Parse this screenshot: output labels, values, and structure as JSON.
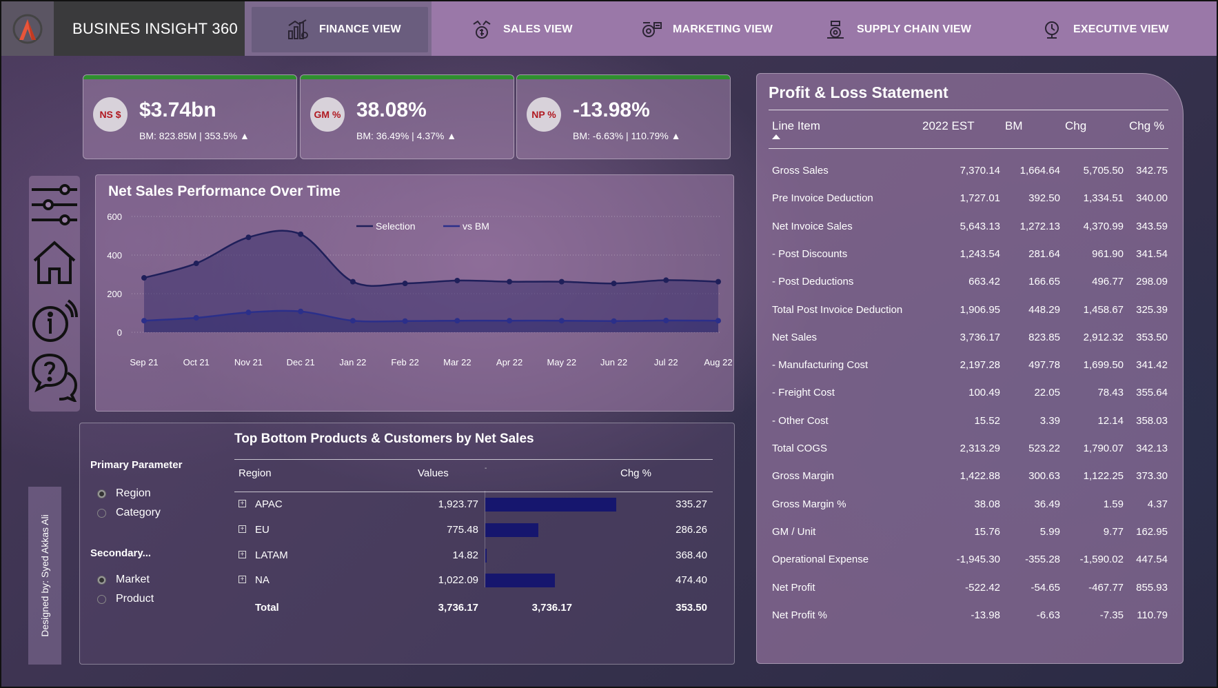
{
  "app": {
    "title": "BUSINES INSIGHT 360",
    "logo_icon": "atliq-logo-icon",
    "brand_color": "#e8553a"
  },
  "nav": [
    {
      "label": "FINANCE VIEW",
      "icon": "finance-chart-icon",
      "active": true
    },
    {
      "label": "SALES VIEW",
      "icon": "sales-icon",
      "active": false
    },
    {
      "label": "MARKETING VIEW",
      "icon": "marketing-icon",
      "active": false
    },
    {
      "label": "SUPPLY CHAIN VIEW",
      "icon": "supply-chain-icon",
      "active": false
    },
    {
      "label": "EXECUTIVE VIEW",
      "icon": "executive-icon",
      "active": false
    }
  ],
  "kpis": [
    {
      "badge": "NS $",
      "value": "$3.74bn",
      "sub": "BM: 823.85M | 353.5% ▲"
    },
    {
      "badge": "GM %",
      "value": "38.08%",
      "sub": "BM: 36.49% | 4.37% ▲"
    },
    {
      "badge": "NP %",
      "value": "-13.98%",
      "sub": "BM: -6.63% | 110.79% ▲"
    }
  ],
  "side_nav": [
    {
      "icon": "filter-sliders-icon"
    },
    {
      "icon": "home-icon"
    },
    {
      "icon": "info-icon"
    },
    {
      "icon": "help-chat-icon"
    }
  ],
  "credit": "Designed by: Syed Akkas Ali",
  "chart": {
    "title": "Net Sales Performance Over Time"
  },
  "chart_data": {
    "type": "area",
    "title": "Net Sales Performance Over Time",
    "categories": [
      "Sep 21",
      "Oct 21",
      "Nov 21",
      "Dec 21",
      "Jan 22",
      "Feb 22",
      "Mar 22",
      "Apr 22",
      "May 22",
      "Jun 22",
      "Jul 22",
      "Aug 22"
    ],
    "series": [
      {
        "name": "Selection",
        "values": [
          282,
          357,
          492,
          508,
          262,
          253,
          268,
          262,
          262,
          253,
          270,
          262
        ],
        "color": "#1f1f5a"
      },
      {
        "name": "vs BM",
        "values": [
          60,
          75,
          103,
          108,
          60,
          58,
          60,
          60,
          60,
          58,
          61,
          60
        ],
        "color": "#2b2f8a"
      }
    ],
    "ylim": [
      0,
      600
    ],
    "yticks": [
      0,
      200,
      400,
      600
    ],
    "legend": "top-center",
    "grid": true
  },
  "top_bottom": {
    "title": "Top Bottom Products & Customers by Net Sales",
    "primary_title": "Primary Parameter",
    "primary_options": [
      {
        "label": "Region",
        "selected": true
      },
      {
        "label": "Category",
        "selected": false
      }
    ],
    "secondary_title": "Secondary...",
    "secondary_options": [
      {
        "label": "Market",
        "selected": true
      },
      {
        "label": "Product",
        "selected": false
      }
    ],
    "columns": {
      "region": "Region",
      "values": "Values",
      "dash": "-",
      "chg": "Chg %"
    },
    "rows": [
      {
        "label": "APAC",
        "value": "1,923.77",
        "chg": "335.27",
        "bar": 1923.77
      },
      {
        "label": "EU",
        "value": "775.48",
        "chg": "286.26",
        "bar": 775.48
      },
      {
        "label": "LATAM",
        "value": "14.82",
        "chg": "368.40",
        "bar": 14.82
      },
      {
        "label": "NA",
        "value": "1,022.09",
        "chg": "474.40",
        "bar": 1022.09
      }
    ],
    "total": {
      "label": "Total",
      "value": "3,736.17",
      "bar_total": "3,736.17",
      "chg": "353.50"
    },
    "bar_color": "#16166e"
  },
  "pl": {
    "title": "Profit & Loss Statement",
    "headers": [
      "Line Item",
      "2022 EST",
      "BM",
      "Chg",
      "Chg %"
    ],
    "rows": [
      [
        "Gross Sales",
        "7,370.14",
        "1,664.64",
        "5,705.50",
        "342.75"
      ],
      [
        "Pre Invoice Deduction",
        "1,727.01",
        "392.50",
        "1,334.51",
        "340.00"
      ],
      [
        "Net Invoice Sales",
        "5,643.13",
        "1,272.13",
        "4,370.99",
        "343.59"
      ],
      [
        "- Post Discounts",
        "1,243.54",
        "281.64",
        "961.90",
        "341.54"
      ],
      [
        "- Post Deductions",
        "663.42",
        "166.65",
        "496.77",
        "298.09"
      ],
      [
        "Total Post Invoice Deduction",
        "1,906.95",
        "448.29",
        "1,458.67",
        "325.39"
      ],
      [
        "Net Sales",
        "3,736.17",
        "823.85",
        "2,912.32",
        "353.50"
      ],
      [
        "- Manufacturing Cost",
        "2,197.28",
        "497.78",
        "1,699.50",
        "341.42"
      ],
      [
        "- Freight Cost",
        "100.49",
        "22.05",
        "78.43",
        "355.64"
      ],
      [
        "- Other Cost",
        "15.52",
        "3.39",
        "12.14",
        "358.03"
      ],
      [
        "Total COGS",
        "2,313.29",
        "523.22",
        "1,790.07",
        "342.13"
      ],
      [
        "Gross Margin",
        "1,422.88",
        "300.63",
        "1,122.25",
        "373.30"
      ],
      [
        "Gross Margin %",
        "38.08",
        "36.49",
        "1.59",
        "4.37"
      ],
      [
        "GM / Unit",
        "15.76",
        "5.99",
        "9.77",
        "162.95"
      ],
      [
        "Operational Expense",
        "-1,945.30",
        "-355.28",
        "-1,590.02",
        "447.54"
      ],
      [
        "Net Profit",
        "-522.42",
        "-54.65",
        "-467.77",
        "855.93"
      ],
      [
        "Net Profit %",
        "-13.98",
        "-6.63",
        "-7.35",
        "110.79"
      ]
    ]
  }
}
